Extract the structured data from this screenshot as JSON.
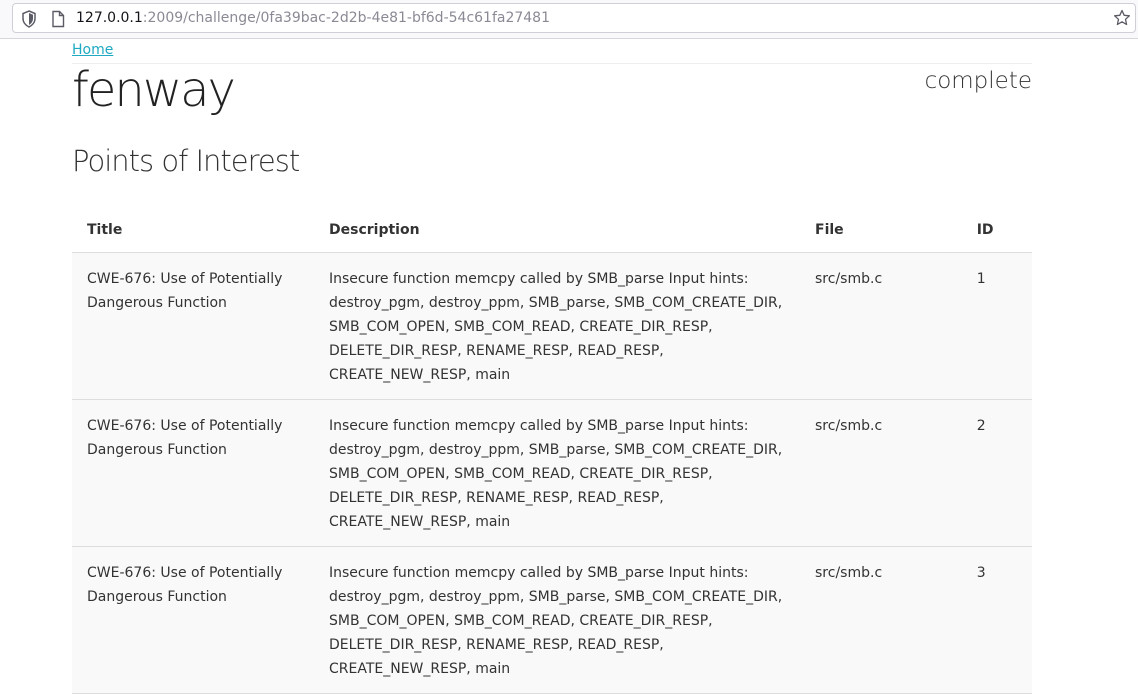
{
  "browser": {
    "url_host": "127.0.0.1",
    "url_rest": ":2009/challenge/0fa39bac-2d2b-4e81-bf6d-54c61fa27481"
  },
  "breadcrumb": {
    "home_label": "Home"
  },
  "challenge": {
    "name": "fenway",
    "status": "complete"
  },
  "section": {
    "title": "Points of Interest"
  },
  "table": {
    "headers": {
      "title": "Title",
      "description": "Description",
      "file": "File",
      "id": "ID"
    },
    "rows": [
      {
        "title": "CWE-676: Use of Potentially Dangerous Function",
        "description": "Insecure function memcpy called by SMB_parse Input hints: destroy_pgm, destroy_ppm, SMB_parse, SMB_COM_CREATE_DIR, SMB_COM_OPEN, SMB_COM_READ, CREATE_DIR_RESP, DELETE_DIR_RESP, RENAME_RESP, READ_RESP, CREATE_NEW_RESP, main",
        "file": "src/smb.c",
        "id": "1"
      },
      {
        "title": "CWE-676: Use of Potentially Dangerous Function",
        "description": "Insecure function memcpy called by SMB_parse Input hints: destroy_pgm, destroy_ppm, SMB_parse, SMB_COM_CREATE_DIR, SMB_COM_OPEN, SMB_COM_READ, CREATE_DIR_RESP, DELETE_DIR_RESP, RENAME_RESP, READ_RESP, CREATE_NEW_RESP, main",
        "file": "src/smb.c",
        "id": "2"
      },
      {
        "title": "CWE-676: Use of Potentially Dangerous Function",
        "description": "Insecure function memcpy called by SMB_parse Input hints: destroy_pgm, destroy_ppm, SMB_parse, SMB_COM_CREATE_DIR, SMB_COM_OPEN, SMB_COM_READ, CREATE_DIR_RESP, DELETE_DIR_RESP, RENAME_RESP, READ_RESP, CREATE_NEW_RESP, main",
        "file": "src/smb.c",
        "id": "3"
      }
    ]
  }
}
